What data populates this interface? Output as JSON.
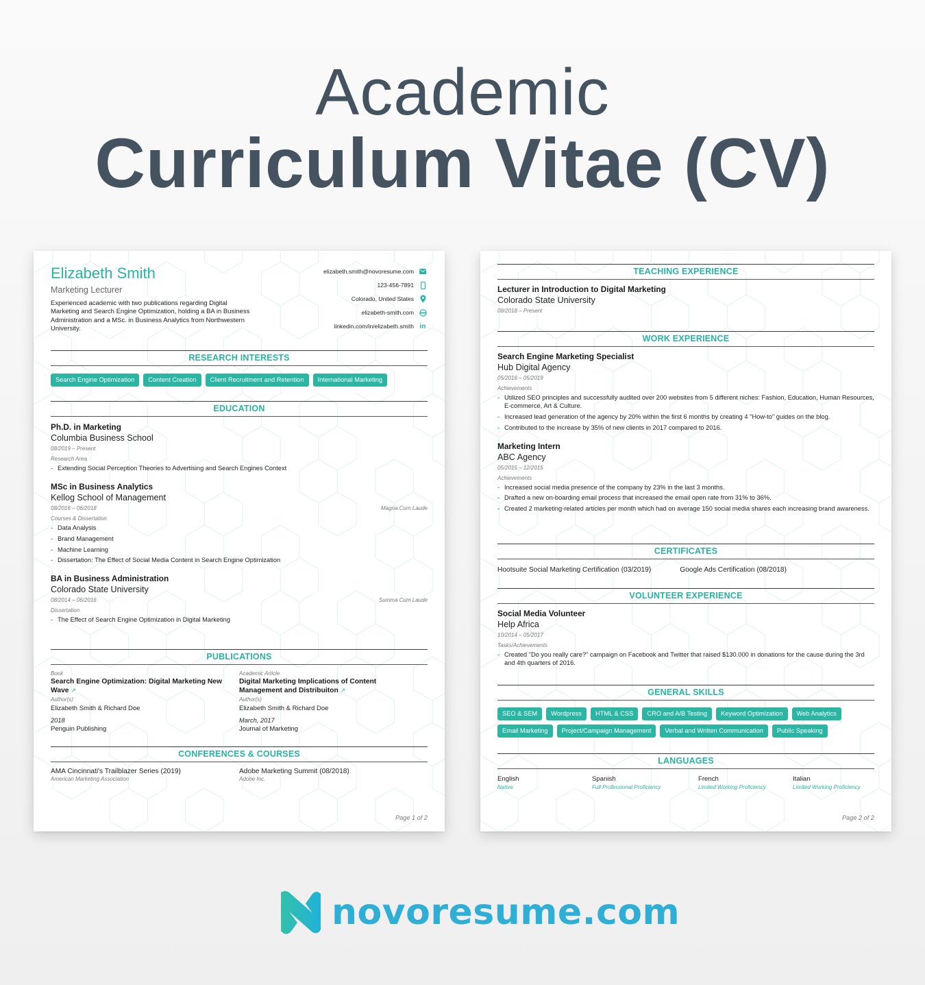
{
  "hero": {
    "line1": "Academic",
    "line2": "Curriculum Vitae (CV)"
  },
  "colors": {
    "accent": "#2ab3a3",
    "heading": "#44535f",
    "logo": "#2fafd6"
  },
  "page1": {
    "name": "Elizabeth Smith",
    "role": "Marketing Lecturer",
    "summary": "Experienced academic with two publications regarding Digital Marketing and Search Engine Optimization, holding a BA in Business Administration and a MSc. in Business Analytics from Northwestern University.",
    "contacts": [
      {
        "text": "elizabeth.smith@novoresume.com",
        "icon": "envelope-icon"
      },
      {
        "text": "123-456-7891",
        "icon": "phone-icon"
      },
      {
        "text": "Colorado, United States",
        "icon": "location-pin-icon"
      },
      {
        "text": "elizabeth-smith.com",
        "icon": "globe-icon"
      },
      {
        "text": "linkedin.com/in/elizabeth.smith",
        "icon": "linkedin-icon"
      }
    ],
    "research": {
      "heading": "RESEARCH INTERESTS",
      "tags": [
        "Search Engine Optimization",
        "Content Creation",
        "Client Recruitment and Retention",
        "International Marketing"
      ]
    },
    "education": {
      "heading": "EDUCATION",
      "entries": [
        {
          "title": "Ph.D. in Marketing",
          "org": "Columbia Business School",
          "dates": "08/2019 – Present",
          "honor": "",
          "label": "Research Area",
          "items": [
            "Extending Social Perception Theories to Advertising and Search Engines Context"
          ]
        },
        {
          "title": "MSc in Business Analytics",
          "org": "Kellog School of Management",
          "dates": "08/2016 – 06/2018",
          "honor": "Magna Cum Laude",
          "label": "Courses & Dissertation",
          "items": [
            "Data Analysis",
            "Brand Management",
            "Machine Learning",
            "Dissertation: The Effect of Social Media Content in Search Engine Optimization"
          ]
        },
        {
          "title": "BA in Business Administration",
          "org": "Colorado State University",
          "dates": "08/2014 – 06/2016",
          "honor": "Summa Cum Laude",
          "label": "Dissertation",
          "items": [
            "The Effect of Search Engine Optimization in Digital Marketing"
          ]
        }
      ]
    },
    "publications": {
      "heading": "PUBLICATIONS",
      "items": [
        {
          "type": "Book",
          "title": "Search Engine Optimization: Digital Marketing New Wave",
          "authors_label": "Author(s)",
          "authors": "Elizabeth Smith & Richard Doe",
          "date": "2018",
          "publisher": "Penguin Publishing"
        },
        {
          "type": "Academic Article",
          "title": "Digital Marketing Implications of Content Management and Distribuiton",
          "authors_label": "Author(s)",
          "authors": "Elizabeth Smith & Richard Doe",
          "date": "March, 2017",
          "publisher": "Journal of Marketing"
        }
      ]
    },
    "conferences": {
      "heading": "CONFERENCES & COURSES",
      "items": [
        {
          "title": "AMA Cincinnati's Trailblazer Series (2019)",
          "org": "American Marketing Association"
        },
        {
          "title": "Adobe Marketing Summit (08/2018)",
          "org": "Adobe Inc."
        }
      ]
    },
    "page_label": "Page 1 of 2"
  },
  "page2": {
    "teaching": {
      "heading": "TEACHING EXPERIENCE",
      "title": "Lecturer in Introduction to Digital Marketing",
      "org": "Colorado State University",
      "dates": "08/2018 – Present"
    },
    "work": {
      "heading": "WORK EXPERIENCE",
      "entries": [
        {
          "title": "Search Engine Marketing Specialist",
          "org": "Hub Digital Agency",
          "dates": "05/2016 – 05/2019",
          "label": "Achievements",
          "items": [
            "Utilized SEO principles and successfully audited over 200 websites from 5 different niches: Fashion, Education, Human Resources, E-commerce, Art & Culture.",
            "Increased lead generation of the agency by 20% within the first 6 months by creating 4 \"How-to\" guides on the blog.",
            "Contributed to the increase by 35% of new clients in 2017 compared to 2016."
          ]
        },
        {
          "title": "Marketing Intern",
          "org": "ABC Agency",
          "dates": "05/2015 – 12/2015",
          "label": "Achievements",
          "items": [
            "Increased social media presence of the company by 23% in the last 3 months.",
            "Drafted a new on-boarding email process that increased the email open rate from 31% to 36%.",
            "Created 2 marketing-related articles per month which had on average 150 social media shares each increasing brand awareness."
          ]
        }
      ]
    },
    "certificates": {
      "heading": "CERTIFICATES",
      "items": [
        "Hootsuite Social Marketing Certification (03/2019)",
        "Google Ads Certification (08/2018)"
      ]
    },
    "volunteer": {
      "heading": "VOLUNTEER EXPERIENCE",
      "title": "Social Media Volunteer",
      "org": "Help Africa",
      "dates": "10/2014 – 05/2017",
      "label": "Tasks/Achievements",
      "items": [
        "Created \"Do you really care?\" campaign on Facebook and Twitter that raised $130.000 in donations for the cause during the 3rd and 4th quarters of 2016."
      ]
    },
    "skills": {
      "heading": "GENERAL SKILLS",
      "tags": [
        "SEO & SEM",
        "Wordpress",
        "HTML & CSS",
        "CRO and A/B Testing",
        "Keyword Optimization",
        "Web Analytics",
        "Email Marketing",
        "Project/Campaign Management",
        "Verbal and Written Communication",
        "Public Speaking"
      ]
    },
    "languages": {
      "heading": "LANGUAGES",
      "items": [
        {
          "name": "English",
          "level": "Native"
        },
        {
          "name": "Spanish",
          "level": "Full Professional Proficiency"
        },
        {
          "name": "French",
          "level": "Limited Working Proficiency"
        },
        {
          "name": "Italian",
          "level": "Limited Working Proficiency"
        }
      ]
    },
    "page_label": "Page 2 of 2"
  },
  "logo": {
    "text": "novoresume.com"
  }
}
